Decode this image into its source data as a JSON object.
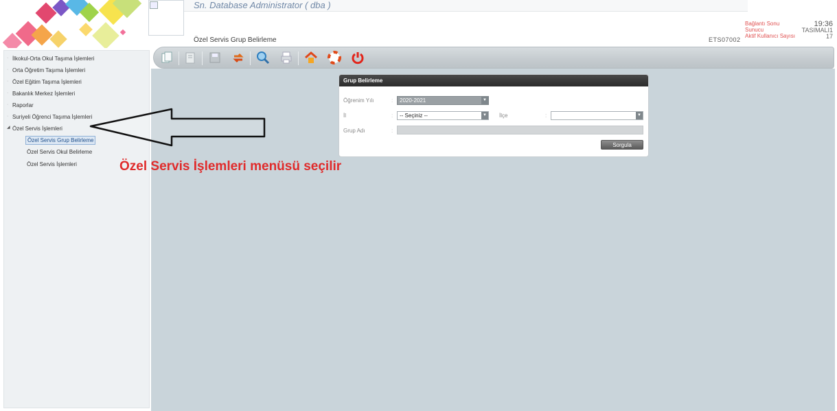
{
  "header": {
    "user_name": "Sn. Database Administrator ( dba )",
    "page_title": "Özel Servis Grup Belirleme",
    "session_code": "ETS07002",
    "status_labels": [
      "Bağlantı Sonu",
      "Sunucu",
      "Aktif Kullanıcı Sayısı"
    ],
    "time": "19:36",
    "server": "TASIMALI1",
    "active_users": "17"
  },
  "toolbar": {
    "buttons": [
      "copy-icon",
      "delete-icon",
      "save-icon",
      "refresh-icon",
      "search-icon",
      "print-icon",
      "home-icon",
      "help-icon",
      "power-icon"
    ]
  },
  "sidebar": {
    "items": [
      "İlkokul-Orta Okul Taşıma İşlemleri",
      "Orta Öğretim Taşıma İşlemleri",
      "Özel Eğitim Taşıma İşlemleri",
      "Bakanlık Merkez İşlemleri",
      "Raporlar",
      "Suriyeli Öğrenci Taşıma İşlemleri",
      "Özel Servis İşlemleri"
    ],
    "subitems": [
      "Özel Servis Grup Belirleme",
      "Özel Servis Okul Belirleme",
      "Özel Servis İşlemleri"
    ]
  },
  "dialog": {
    "title": "Grup Belirleme",
    "year_label": "Öğrenim Yılı",
    "year_value": "2020-2021",
    "il_label": "İl",
    "il_value": "-- Seçiniz --",
    "ilce_label": "İlçe",
    "ilce_value": "",
    "group_label": "Grup Adı",
    "query_button": "Sorgula"
  },
  "annotation": {
    "text": "Özel Servis İşlemleri menüsü seçilir"
  }
}
